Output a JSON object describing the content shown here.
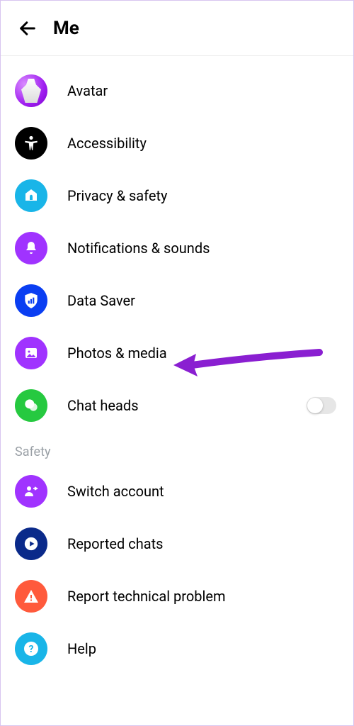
{
  "header": {
    "title": "Me"
  },
  "items": [
    {
      "label": "Avatar",
      "icon": "avatar-icon",
      "bg": "avatar"
    },
    {
      "label": "Accessibility",
      "icon": "accessibility-icon",
      "bg": "#000000"
    },
    {
      "label": "Privacy & safety",
      "icon": "home-lock-icon",
      "bg": "#19b5e8"
    },
    {
      "label": "Notifications & sounds",
      "icon": "bell-icon",
      "bg": "#a033ff"
    },
    {
      "label": "Data Saver",
      "icon": "shield-bars-icon",
      "bg": "#0a3ef2"
    },
    {
      "label": "Photos & media",
      "icon": "photo-icon",
      "bg": "#a033ff"
    },
    {
      "label": "Chat heads",
      "icon": "chat-heads-icon",
      "bg": "#26c940",
      "toggle": false
    }
  ],
  "section": "Safety",
  "safety_items": [
    {
      "label": "Switch account",
      "icon": "switch-account-icon",
      "bg": "#a033ff"
    },
    {
      "label": "Reported chats",
      "icon": "flag-icon",
      "bg": "#0a2a8a"
    },
    {
      "label": "Report technical problem",
      "icon": "warning-icon",
      "bg": "#ff5a3c"
    },
    {
      "label": "Help",
      "icon": "help-icon",
      "bg": "#19b5e8"
    }
  ],
  "annotation": {
    "target": "Photos & media",
    "color": "#8a1fd1"
  }
}
